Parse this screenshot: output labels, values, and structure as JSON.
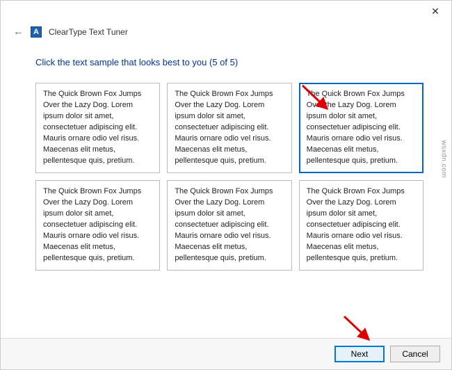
{
  "window": {
    "app_icon_letter": "A",
    "app_title": "ClearType Text Tuner",
    "close_glyph": "✕"
  },
  "header": {
    "back_glyph": "←"
  },
  "main": {
    "instruction": "Click the text sample that looks best to you (5 of 5)",
    "sample_text": "The Quick Brown Fox Jumps Over the Lazy Dog. Lorem ipsum dolor sit amet, consectetuer adipiscing elit. Mauris ornare odio vel risus. Maecenas elit metus, pellentesque quis, pretium.",
    "selected_index": 2
  },
  "footer": {
    "next_label": "Next",
    "cancel_label": "Cancel"
  },
  "watermark": "wsxdn.com"
}
